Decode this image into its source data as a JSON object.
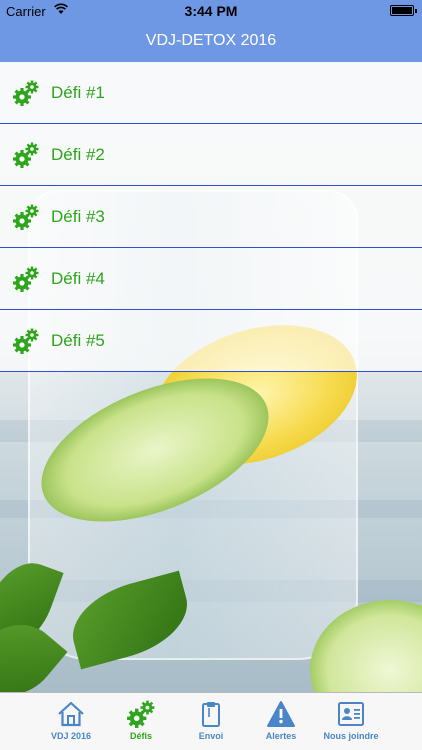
{
  "status_bar": {
    "carrier": "Carrier",
    "time": "3:44 PM"
  },
  "nav": {
    "title": "VDJ-DETOX 2016"
  },
  "list": {
    "items": [
      {
        "label": "Défi #1",
        "icon": "gears-icon"
      },
      {
        "label": "Défi #2",
        "icon": "gears-icon"
      },
      {
        "label": "Défi #3",
        "icon": "gears-icon"
      },
      {
        "label": "Défi #4",
        "icon": "gears-icon"
      },
      {
        "label": "Défi #5",
        "icon": "gears-icon"
      }
    ]
  },
  "tabs": [
    {
      "label": "VDJ 2016",
      "icon": "home-icon",
      "active": false
    },
    {
      "label": "Défis",
      "icon": "gears-icon",
      "active": true
    },
    {
      "label": "Envoi",
      "icon": "clipboard-icon",
      "active": false
    },
    {
      "label": "Alertes",
      "icon": "warning-icon",
      "active": false
    },
    {
      "label": "Nous joindre",
      "icon": "contact-card-icon",
      "active": false
    }
  ],
  "colors": {
    "bar_blue": "#6e98e4",
    "list_green": "#2fa51d",
    "separator_blue": "#2d4fd6",
    "tab_blue": "#4a86c7"
  }
}
